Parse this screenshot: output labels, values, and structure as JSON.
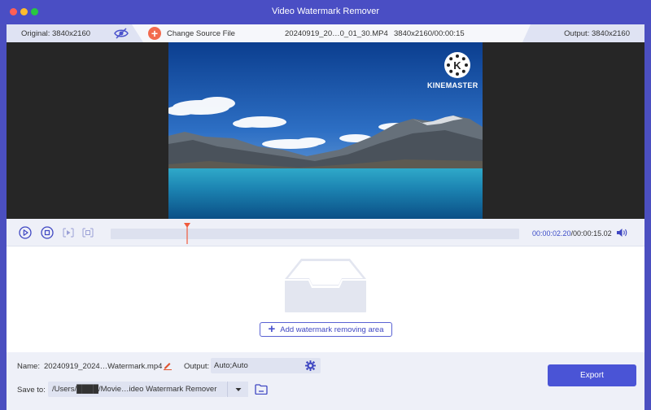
{
  "window": {
    "title": "Video Watermark Remover"
  },
  "infobar": {
    "original": "Original: 3840x2160",
    "change_source": "Change Source File",
    "file_name": "20240919_20…0_01_30.MP4",
    "resolution_duration": "3840x2160/00:00:15",
    "output": "Output: 3840x2160"
  },
  "video": {
    "overlay_logo_text": "KINEMASTER"
  },
  "playback": {
    "current_time": "00:00:02.20",
    "total_time": "/00:00:15.02",
    "progress": 0.187
  },
  "watermark": {
    "add_button_label": "Add watermark removing area"
  },
  "bottom": {
    "name_label": "Name:",
    "name_value": "20240919_2024…Watermark.mp4",
    "output_label": "Output:",
    "output_value": "Auto;Auto",
    "save_to_label": "Save to:",
    "save_path": "/Users/████/Movie…ideo Watermark Remover",
    "export_label": "Export"
  },
  "icons": {
    "eye": "eye-slash-icon",
    "plus": "plus-icon",
    "play": "play-icon",
    "stop": "stop-icon",
    "clip_start": "clip-start-icon",
    "clip_end": "clip-end-icon",
    "volume": "volume-icon",
    "inbox": "inbox-icon",
    "edit": "pencil-icon",
    "gear": "gear-icon",
    "chevron": "chevron-down-icon",
    "folder": "folder-icon"
  },
  "colors": {
    "accent": "#4a54d6",
    "title_bar": "#4a4ec4",
    "add_source": "#f26b4e",
    "playhead": "#f05a3c",
    "edit_icon": "#e0532e"
  }
}
